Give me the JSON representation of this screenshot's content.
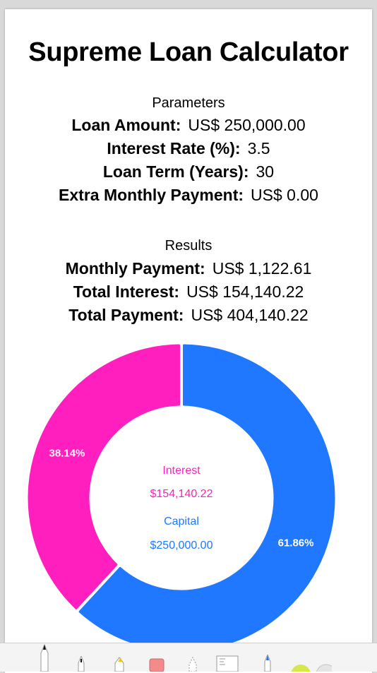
{
  "title": "Supreme Loan Calculator",
  "parameters": {
    "heading": "Parameters",
    "rows": [
      {
        "label": "Loan Amount:",
        "value": "US$ 250,000.00"
      },
      {
        "label": "Interest Rate (%):",
        "value": "3.5"
      },
      {
        "label": "Loan Term (Years):",
        "value": "30"
      },
      {
        "label": "Extra Monthly Payment:",
        "value": "US$ 0.00"
      }
    ]
  },
  "results": {
    "heading": "Results",
    "rows": [
      {
        "label": "Monthly Payment:",
        "value": "US$ 1,122.61"
      },
      {
        "label": "Total Interest:",
        "value": "US$ 154,140.22"
      },
      {
        "label": "Total Payment:",
        "value": "US$ 404,140.22"
      }
    ]
  },
  "chart_data": {
    "type": "pie",
    "categories": [
      "Capital",
      "Interest"
    ],
    "values": [
      250000.0,
      154140.22
    ],
    "percent_labels": [
      "61.86%",
      "38.14%"
    ],
    "center": {
      "interest_label": "Interest",
      "interest_value": "$154,140.22",
      "capital_label": "Capital",
      "capital_value": "$250,000.00"
    },
    "colors": {
      "Capital": "#1f78ff",
      "Interest": "#ff1fbf"
    }
  },
  "toolbar": {
    "tools": [
      "pen-icon",
      "fineliner-icon",
      "marker-icon",
      "eraser-icon",
      "lasso-icon",
      "ruler-icon",
      "color-pen-icon",
      "color-picker-icon"
    ]
  }
}
